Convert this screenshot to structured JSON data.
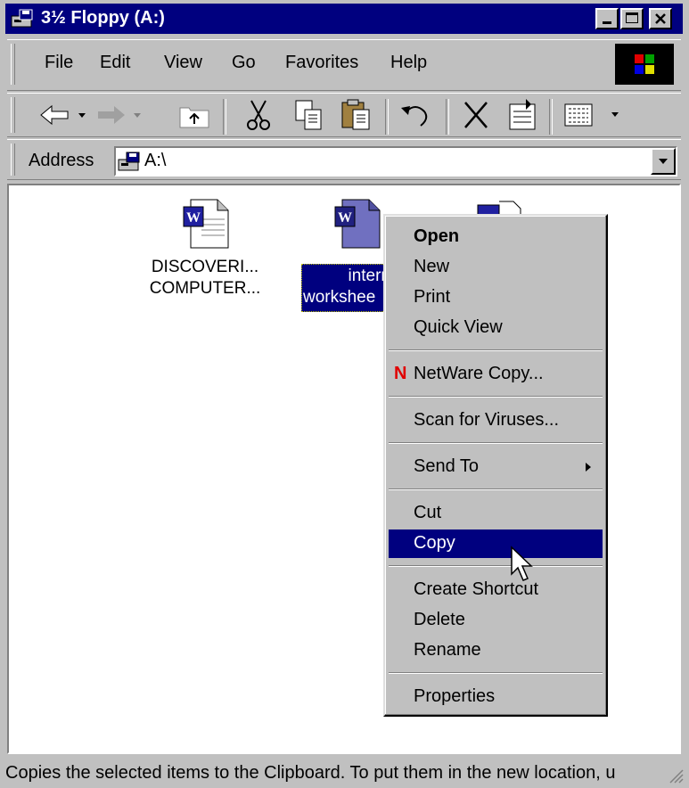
{
  "window": {
    "title": "3½ Floppy (A:)"
  },
  "menubar": {
    "items": [
      {
        "label": "File"
      },
      {
        "label": "Edit"
      },
      {
        "label": "View"
      },
      {
        "label": "Go"
      },
      {
        "label": "Favorites"
      },
      {
        "label": "Help"
      }
    ]
  },
  "toolbar": {
    "buttons": [
      "back-icon",
      "forward-icon",
      "up-folder-icon",
      "cut-icon",
      "copy-icon",
      "paste-icon",
      "undo-icon",
      "delete-icon",
      "properties-icon",
      "views-icon"
    ]
  },
  "address": {
    "label": "Address",
    "value": "A:\\"
  },
  "files": [
    {
      "name_line1": "DISCOVERI...",
      "name_line2": "COMPUTER...",
      "selected": false
    },
    {
      "name_line1": "intern",
      "name_line2": "workshee",
      "selected": true
    }
  ],
  "context_menu": {
    "items": [
      {
        "label": "Open"
      },
      {
        "label": "New"
      },
      {
        "label": "Print"
      },
      {
        "label": "Quick View"
      },
      {
        "label": "NetWare Copy..."
      },
      {
        "label": "Scan for Viruses..."
      },
      {
        "label": "Send To"
      },
      {
        "label": "Cut"
      },
      {
        "label": "Copy"
      },
      {
        "label": "Create Shortcut"
      },
      {
        "label": "Delete"
      },
      {
        "label": "Rename"
      },
      {
        "label": "Properties"
      }
    ],
    "highlighted": "Copy"
  },
  "status": {
    "text": "Copies the selected items to the Clipboard. To put them in the new location, u"
  },
  "colors": {
    "titlebar": "#00007f",
    "face": "#c0c0c0",
    "highlight": "#00007f",
    "netware_n": "#e00000"
  }
}
